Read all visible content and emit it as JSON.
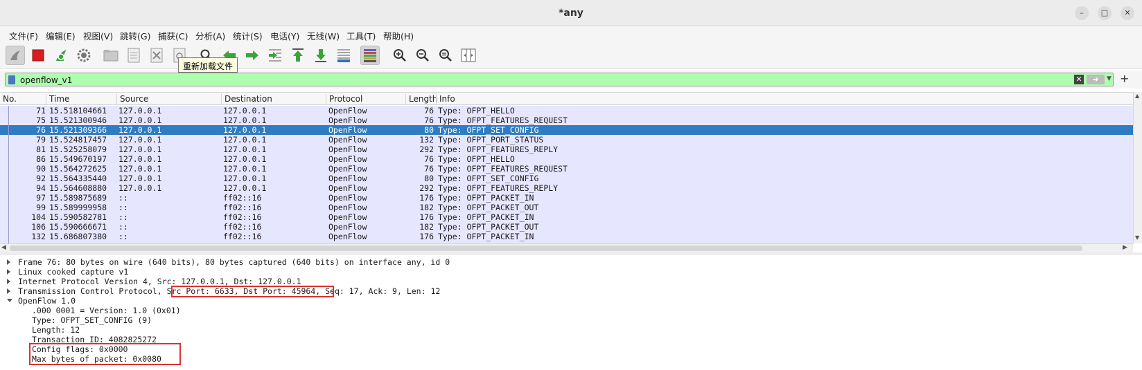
{
  "window": {
    "title": "*any"
  },
  "menu": [
    "文件(F)",
    "编辑(E)",
    "视图(V)",
    "跳转(G)",
    "捕获(C)",
    "分析(A)",
    "统计(S)",
    "电话(Y)",
    "无线(W)",
    "工具(T)",
    "帮助(H)"
  ],
  "toolbar": {
    "tooltip": "重新加载文件"
  },
  "filter": {
    "value": "openflow_v1"
  },
  "columns": [
    "No.",
    "Time",
    "Source",
    "Destination",
    "Protocol",
    "Length",
    "Info"
  ],
  "packets": [
    {
      "no": "71",
      "time": "15.518104661",
      "src": "127.0.0.1",
      "dst": "127.0.0.1",
      "proto": "OpenFlow",
      "len": "76",
      "info": "Type: OFPT_HELLO"
    },
    {
      "no": "75",
      "time": "15.521300946",
      "src": "127.0.0.1",
      "dst": "127.0.0.1",
      "proto": "OpenFlow",
      "len": "76",
      "info": "Type: OFPT_FEATURES_REQUEST"
    },
    {
      "no": "76",
      "time": "15.521309366",
      "src": "127.0.0.1",
      "dst": "127.0.0.1",
      "proto": "OpenFlow",
      "len": "80",
      "info": "Type: OFPT_SET_CONFIG"
    },
    {
      "no": "79",
      "time": "15.524817457",
      "src": "127.0.0.1",
      "dst": "127.0.0.1",
      "proto": "OpenFlow",
      "len": "132",
      "info": "Type: OFPT_PORT_STATUS"
    },
    {
      "no": "81",
      "time": "15.525258079",
      "src": "127.0.0.1",
      "dst": "127.0.0.1",
      "proto": "OpenFlow",
      "len": "292",
      "info": "Type: OFPT_FEATURES_REPLY"
    },
    {
      "no": "86",
      "time": "15.549670197",
      "src": "127.0.0.1",
      "dst": "127.0.0.1",
      "proto": "OpenFlow",
      "len": "76",
      "info": "Type: OFPT_HELLO"
    },
    {
      "no": "90",
      "time": "15.564272625",
      "src": "127.0.0.1",
      "dst": "127.0.0.1",
      "proto": "OpenFlow",
      "len": "76",
      "info": "Type: OFPT_FEATURES_REQUEST"
    },
    {
      "no": "92",
      "time": "15.564335440",
      "src": "127.0.0.1",
      "dst": "127.0.0.1",
      "proto": "OpenFlow",
      "len": "80",
      "info": "Type: OFPT_SET_CONFIG"
    },
    {
      "no": "94",
      "time": "15.564608880",
      "src": "127.0.0.1",
      "dst": "127.0.0.1",
      "proto": "OpenFlow",
      "len": "292",
      "info": "Type: OFPT_FEATURES_REPLY"
    },
    {
      "no": "97",
      "time": "15.589875689",
      "src": "::",
      "dst": "ff02::16",
      "proto": "OpenFlow",
      "len": "176",
      "info": "Type: OFPT_PACKET_IN"
    },
    {
      "no": "99",
      "time": "15.589999958",
      "src": "::",
      "dst": "ff02::16",
      "proto": "OpenFlow",
      "len": "182",
      "info": "Type: OFPT_PACKET_OUT"
    },
    {
      "no": "104",
      "time": "15.590582781",
      "src": "::",
      "dst": "ff02::16",
      "proto": "OpenFlow",
      "len": "176",
      "info": "Type: OFPT_PACKET_IN"
    },
    {
      "no": "106",
      "time": "15.590666671",
      "src": "::",
      "dst": "ff02::16",
      "proto": "OpenFlow",
      "len": "182",
      "info": "Type: OFPT_PACKET_OUT"
    },
    {
      "no": "132",
      "time": "15.686807380",
      "src": "::",
      "dst": "ff02::16",
      "proto": "OpenFlow",
      "len": "176",
      "info": "Type: OFPT_PACKET_IN"
    }
  ],
  "details": {
    "frame": "Frame 76: 80 bytes on wire (640 bits), 80 bytes captured (640 bits) on interface any, id 0",
    "linux": "Linux cooked capture v1",
    "ip": "Internet Protocol Version 4, Src: 127.0.0.1, Dst: 127.0.0.1",
    "tcp_prefix": "Transmission Control Protocol, ",
    "tcp_ports": "Src Port: 6633, Dst Port: 45964,",
    "tcp_suffix": " Seq: 17, Ack: 9, Len: 12",
    "openflow": "OpenFlow 1.0",
    "fields": [
      ".000 0001 = Version: 1.0 (0x01)",
      "Type: OFPT_SET_CONFIG (9)",
      "Length: 12",
      "Transaction ID: 4082825272",
      "Config flags: 0x0000",
      "Max bytes of packet: 0x0080"
    ]
  }
}
